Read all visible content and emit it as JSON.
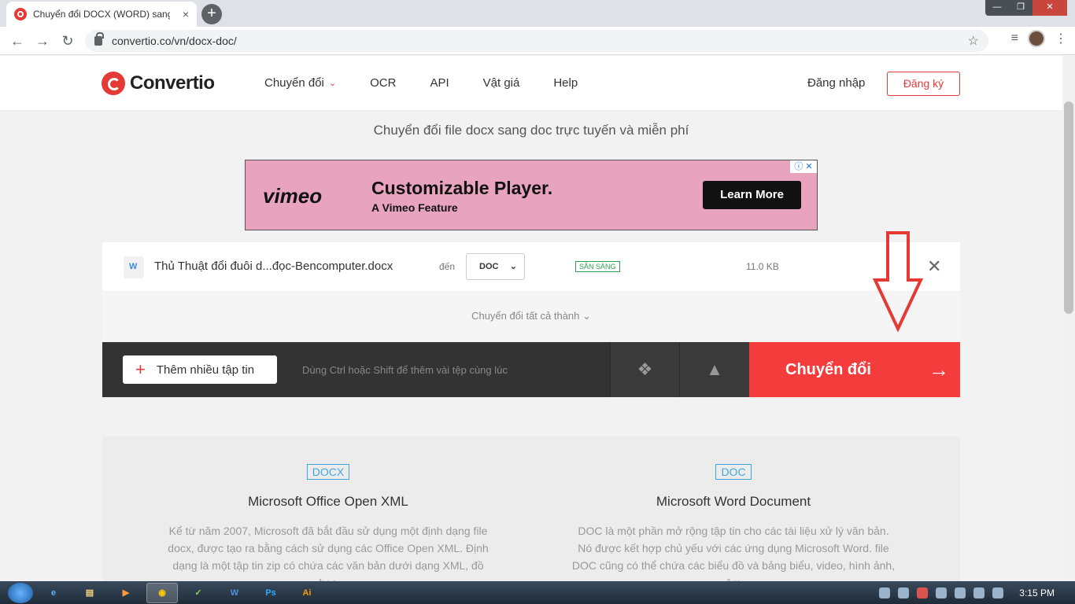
{
  "browser": {
    "tab_title": "Chuyển đổi DOCX (WORD) sang",
    "tab_close": "×",
    "new_tab": "+",
    "url": "convertio.co/vn/docx-doc/",
    "back": "←",
    "forward": "→",
    "reload": "↻",
    "star": "☆",
    "window_controls": [
      "—",
      "❐",
      "✕"
    ]
  },
  "header": {
    "logo_text": "Convertio",
    "nav": [
      {
        "label": "Chuyển đổi",
        "caret": "⌄"
      },
      {
        "label": "OCR"
      },
      {
        "label": "API"
      },
      {
        "label": "Vật giá"
      },
      {
        "label": "Help"
      }
    ],
    "login": "Đăng nhập",
    "register": "Đăng ký"
  },
  "hero": {
    "subtitle": "Chuyển đổi file docx sang doc trực tuyến và miễn phí"
  },
  "ad": {
    "brand": "vimeo",
    "headline": "Customizable Player.",
    "subline": "A Vimeo Feature",
    "cta": "Learn More",
    "info": "ⓘ ✕"
  },
  "file": {
    "name": "Thủ Thuật đổi đuôi d...đọc-Bencomputer.docx",
    "to_label": "đến",
    "format": "DOC",
    "format_chevron": "⌄",
    "status": "SẴN SÀNG",
    "size": "11.0 KB",
    "remove": "✕"
  },
  "convert_all": "Chuyển đổi tất cả thành ⌄",
  "actions": {
    "add_files": "Thêm nhiều tập tin",
    "add_plus": "+",
    "hint": "Dùng Ctrl hoặc Shift để thêm vài tệp cùng lúc",
    "dropbox_icon": "❖",
    "drive_icon": "▲",
    "convert": "Chuyển đổi",
    "convert_arrow": "→"
  },
  "annotation": {
    "color": "#e53935"
  },
  "info": {
    "left": {
      "badge": "DOCX",
      "title": "Microsoft Office Open XML",
      "desc": "Kể từ năm 2007, Microsoft đã bắt đầu sử dụng một định dạng file docx, được tạo ra bằng cách sử dụng các Office Open XML. Định dạng là một tập tin zip có chứa các văn bản dưới dạng XML, đồ họa"
    },
    "right": {
      "badge": "DOC",
      "title": "Microsoft Word Document",
      "desc": "DOC là một phần mở rộng tập tin cho các tài liệu xử lý văn bản. Nó được kết hợp chủ yếu với các ứng dụng Microsoft Word. file DOC cũng có thể chứa các biểu đồ và bảng biểu, video, hình ảnh, âm"
    }
  },
  "taskbar": {
    "apps": [
      "e",
      "▤",
      "▶",
      "◉",
      "✓",
      "W",
      "Ps",
      "Ai"
    ],
    "clock": "3:15 PM"
  },
  "colors": {
    "brand": "#e53935",
    "convert": "#f43c3c",
    "ready": "#2ca24f",
    "badge": "#3fa7e0"
  }
}
